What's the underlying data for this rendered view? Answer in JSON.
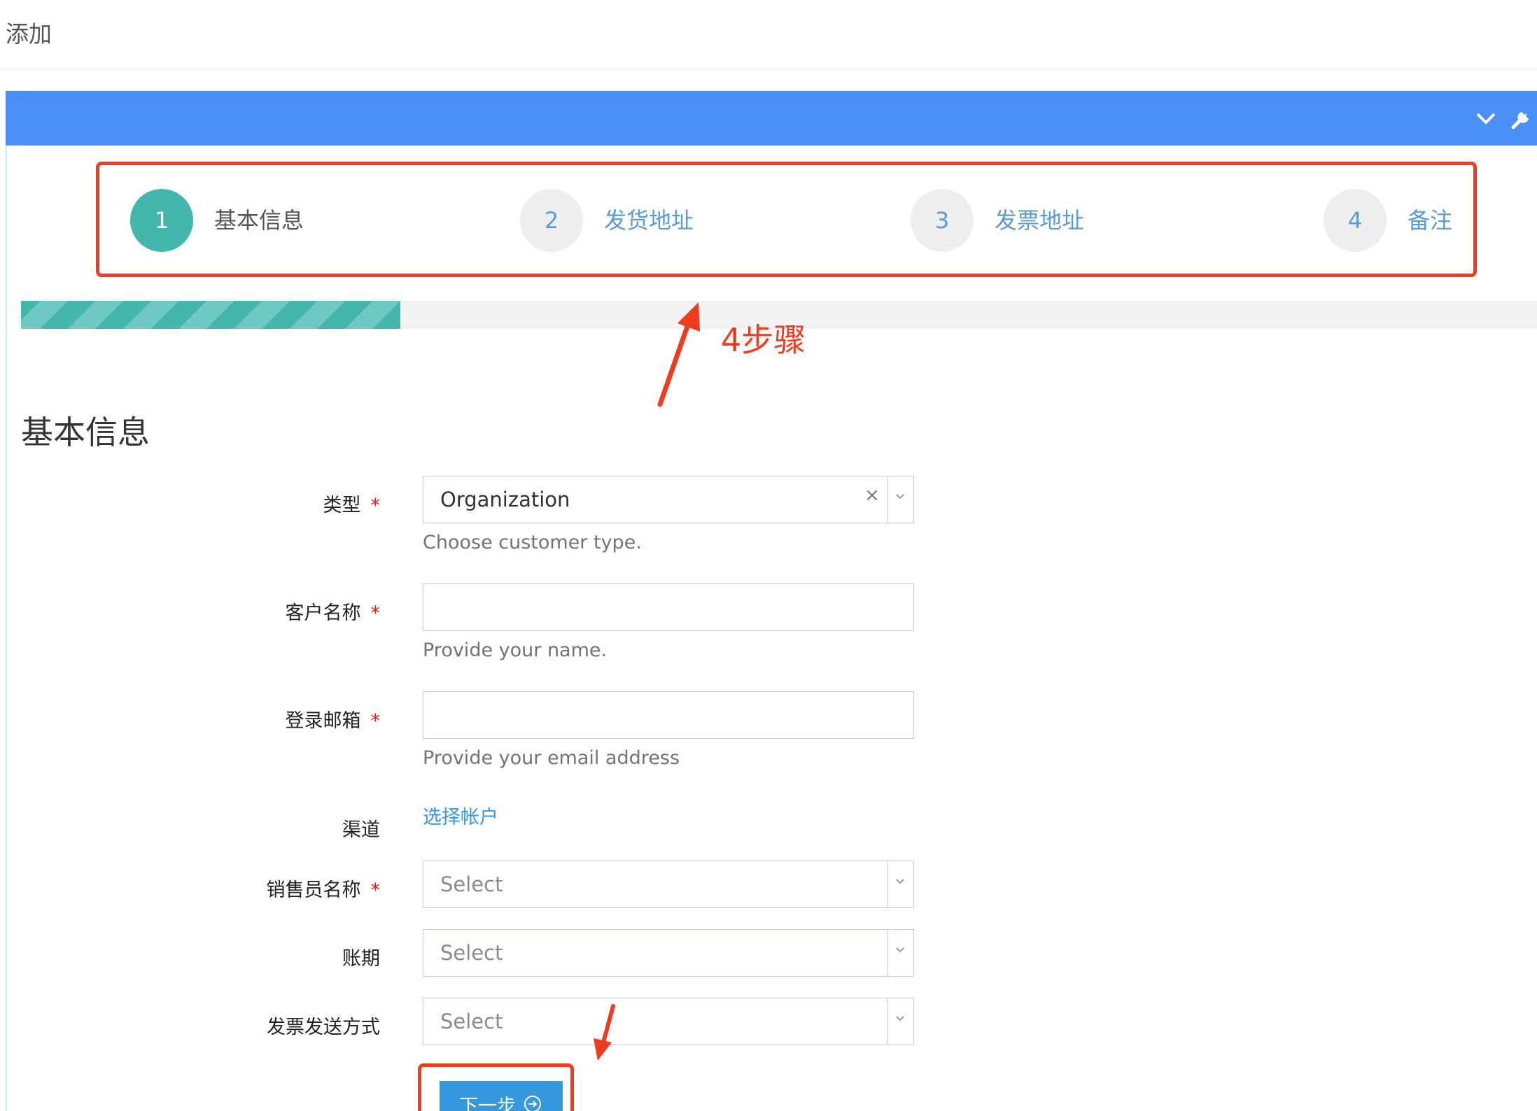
{
  "page": {
    "title": "添加"
  },
  "wizard": {
    "steps": [
      {
        "number": "1",
        "label": "基本信息"
      },
      {
        "number": "2",
        "label": "发货地址"
      },
      {
        "number": "3",
        "label": "发票地址"
      },
      {
        "number": "4",
        "label": "备注"
      }
    ],
    "active_step": 1,
    "progress_fraction": 0.25
  },
  "form": {
    "section_title": "基本信息",
    "required_mark": "*",
    "type": {
      "label": "类型",
      "value": "Organization",
      "help": "Choose customer type."
    },
    "customer_name": {
      "label": "客户名称",
      "value": "",
      "help": "Provide your name."
    },
    "login_email": {
      "label": "登录邮箱",
      "value": "",
      "help": "Provide your email address"
    },
    "channel": {
      "label": "渠道",
      "link": "选择帐户"
    },
    "salesperson": {
      "label": "销售员名称",
      "placeholder": "Select"
    },
    "payment_terms": {
      "label": "账期",
      "placeholder": "Select"
    },
    "invoice_delivery": {
      "label": "发票发送方式",
      "placeholder": "Select"
    },
    "next_button": {
      "label": "下一步"
    }
  },
  "annotation": {
    "text": "4步骤",
    "color": "#f03c1e"
  },
  "colors": {
    "header_bar": "#4a8ef8",
    "active_step": "#44b6ae",
    "link": "#3598dc",
    "button": "#3598dc"
  }
}
